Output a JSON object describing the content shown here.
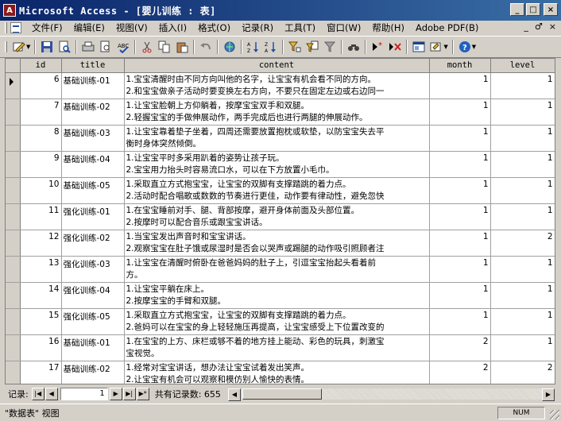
{
  "window": {
    "title": "Microsoft Access - [婴儿训练 : 表]",
    "min_label": "_",
    "max_label": "□",
    "close_label": "×"
  },
  "menu": {
    "items": [
      {
        "label": "文件(F)"
      },
      {
        "label": "编辑(E)"
      },
      {
        "label": "视图(V)"
      },
      {
        "label": "插入(I)"
      },
      {
        "label": "格式(O)"
      },
      {
        "label": "记录(R)"
      },
      {
        "label": "工具(T)"
      },
      {
        "label": "窗口(W)"
      },
      {
        "label": "帮助(H)"
      },
      {
        "label": "Adobe PDF(B)"
      }
    ],
    "mdi_min": "_",
    "mdi_restore": "♂",
    "mdi_close": "×"
  },
  "toolbar": {
    "icons": [
      "design-view-icon",
      "save-icon",
      "search-file-icon",
      "print-icon",
      "print-preview-icon",
      "spell-check-icon",
      "cut-icon",
      "copy-icon",
      "paste-icon",
      "undo-icon",
      "insert-hyperlink-icon",
      "sort-ascending-icon",
      "sort-descending-icon",
      "filter-by-selection-icon",
      "filter-by-form-icon",
      "apply-filter-icon",
      "find-icon",
      "new-record-icon",
      "delete-record-icon",
      "database-window-icon",
      "new-object-icon",
      "help-icon"
    ]
  },
  "table": {
    "columns": [
      "id",
      "title",
      "content",
      "month",
      "level"
    ],
    "rows": [
      {
        "id": "6",
        "title": "基础训练-01",
        "content": [
          "1.宝宝清醒时由不同方向叫他的名字，让宝宝有机会看不同的方向。",
          "2.和宝宝做亲子活动时要变换左右方向，不要只在固定左边或右边同一"
        ],
        "month": "1",
        "level": "1",
        "current": true
      },
      {
        "id": "7",
        "title": "基础训练-02",
        "content": [
          "1.让宝宝脸朝上方仰躺着，按摩宝宝双手和双腿。",
          "2.轻握宝宝的手做伸展动作，两手完成后也进行两腿的伸展动作。"
        ],
        "month": "1",
        "level": "1"
      },
      {
        "id": "8",
        "title": "基础训练-03",
        "content": [
          "1.让宝宝靠着垫子坐着，四周还需要放置抱枕或软垫，以防宝宝失去平",
          "衡时身体突然倾倒。"
        ],
        "month": "1",
        "level": "1"
      },
      {
        "id": "9",
        "title": "基础训练-04",
        "content": [
          "1.让宝宝平时多采用趴着的姿势让孩子玩。",
          "2.宝宝用力抬头时容易流口水，可以在下方放置小毛巾。"
        ],
        "month": "1",
        "level": "1"
      },
      {
        "id": "10",
        "title": "基础训练-05",
        "content": [
          "1.采取直立方式抱宝宝，让宝宝的双脚有支撑踏跳的着力点。",
          "2.活动时配合唱歌或数数的节奏进行更佳，动作要有律动性，避免忽快"
        ],
        "month": "1",
        "level": "1"
      },
      {
        "id": "11",
        "title": "强化训练-01",
        "content": [
          "1.在宝宝睡前对手、腿、背部按摩，避开身体前面及头部位置。",
          "2.按摩时可以配合音乐或跟宝宝讲话。"
        ],
        "month": "1",
        "level": "1"
      },
      {
        "id": "12",
        "title": "强化训练-02",
        "content": [
          "1.当宝宝发出声音时和宝宝讲话。",
          "2.观察宝宝在肚子饿或尿湿时是否会以哭声或踢腿的动作吸引照顾者注"
        ],
        "month": "1",
        "level": "2"
      },
      {
        "id": "13",
        "title": "强化训练-03",
        "content": [
          "1.让宝宝在清醒时俯卧在爸爸妈妈的肚子上，引逗宝宝抬起头看着前",
          "方。"
        ],
        "month": "1",
        "level": "1"
      },
      {
        "id": "14",
        "title": "强化训练-04",
        "content": [
          "1.让宝宝平躺在床上。",
          "2.按摩宝宝的手臂和双腿。"
        ],
        "month": "1",
        "level": "1"
      },
      {
        "id": "15",
        "title": "强化训练-05",
        "content": [
          "1.采取直立方式抱宝宝，让宝宝的双脚有支撑踏跳的着力点。",
          "2.爸妈可以在宝宝的身上轻轻施压再提高，让宝宝感受上下位置改变的"
        ],
        "month": "1",
        "level": "1"
      },
      {
        "id": "16",
        "title": "基础训练-01",
        "content": [
          "1.在宝宝的上方、床栏或够不着的地方挂上能动、彩色的玩具，刺激宝",
          "宝视觉。"
        ],
        "month": "2",
        "level": "1"
      },
      {
        "id": "17",
        "title": "基础训练-02",
        "content": [
          "1.经常对宝宝讲话，想办法让宝宝试着发出笑声。",
          "2.让宝宝有机会可以观察和模仿别人愉快的表情。"
        ],
        "month": "2",
        "level": "2"
      }
    ]
  },
  "navigation": {
    "label": "记录:",
    "current": "1",
    "total_label": "共有记录数: 655",
    "first": "|◀",
    "prev": "◀",
    "next": "▶",
    "last": "▶|",
    "new": "▶*"
  },
  "status": {
    "text": "\"数据表\" 视图",
    "num": "NUM"
  }
}
